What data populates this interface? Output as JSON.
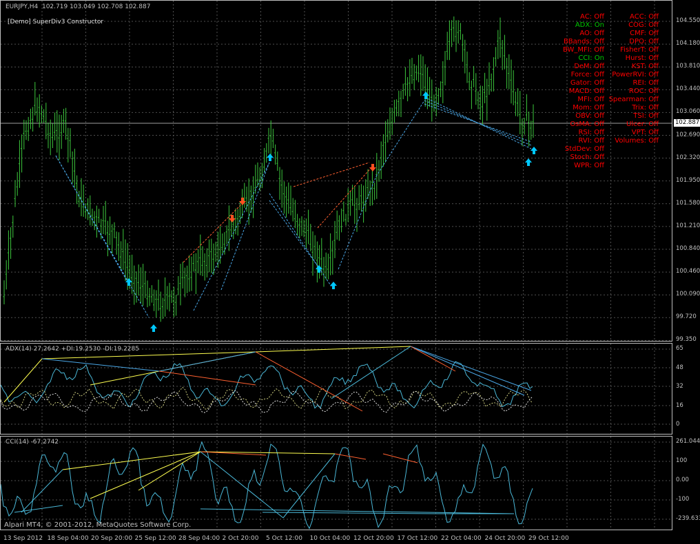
{
  "window": {
    "title": "EURJPY,H4  102.719 103.049 102.708 102.887",
    "indicator_label": "[Demo] SuperDiv3 Constructor",
    "copyright": "Alpari MT4, © 2001-2012, MetaQuotes Software Corp."
  },
  "colors": {
    "background": "#000000",
    "grid": "#606060",
    "bars": "#3cc83c",
    "up_arrow": "#00c8ff",
    "down_arrow": "#ff5020",
    "bull_line": "#4aa8e8",
    "bear_line": "#ff6030",
    "yellow_line": "#ffff50"
  },
  "price_axis": {
    "labels": [
      "104.550",
      "104.180",
      "103.810",
      "103.440",
      "103.060",
      "102.690",
      "102.320",
      "101.950",
      "101.580",
      "101.210",
      "100.840",
      "100.460",
      "100.090",
      "99.720",
      "99.350"
    ],
    "current": "102.887"
  },
  "adx": {
    "title": "ADX(14) 27.2642 +DI:19.2530 -DI:19.2285",
    "axis": [
      "65",
      "48",
      "32",
      "16",
      "0"
    ]
  },
  "cci": {
    "title": "CCI(14) -67.2742",
    "axis": [
      "261.044",
      "100",
      "0.00",
      "-100",
      "-239.633"
    ]
  },
  "time_axis": [
    "13 Sep 2012",
    "18 Sep 04:00",
    "20 Sep 20:00",
    "25 Sep 12:00",
    "28 Sep 04:00",
    "2 Oct 20:00",
    "5 Oct 12:00",
    "10 Oct 04:00",
    "12 Oct 20:00",
    "17 Oct 12:00",
    "22 Oct 04:00",
    "24 Oct 20:00",
    "29 Oct 12:00"
  ],
  "indicators_left": [
    {
      "label": "AC: Off",
      "state": "off"
    },
    {
      "label": "ADX: On",
      "state": "on"
    },
    {
      "label": "AO: Off",
      "state": "off"
    },
    {
      "label": "BBands: Off",
      "state": "off"
    },
    {
      "label": "BW_MFI: Off",
      "state": "off"
    },
    {
      "label": "CCI: On",
      "state": "on"
    },
    {
      "label": "DeM: Off",
      "state": "off"
    },
    {
      "label": "Force: Off",
      "state": "off"
    },
    {
      "label": "Gator: Off",
      "state": "off"
    },
    {
      "label": "MACD: Off",
      "state": "off"
    },
    {
      "label": "MFI: Off",
      "state": "off"
    },
    {
      "label": "Mom: Off",
      "state": "off"
    },
    {
      "label": "OBV: Off",
      "state": "off"
    },
    {
      "label": "OsMA: Off",
      "state": "off"
    },
    {
      "label": "RSI: Off",
      "state": "off"
    },
    {
      "label": "RVI: Off",
      "state": "off"
    },
    {
      "label": "StdDev: Off",
      "state": "off"
    },
    {
      "label": "Stoch: Off",
      "state": "off"
    },
    {
      "label": "WPR: Off",
      "state": "off"
    }
  ],
  "indicators_right": [
    {
      "label": "ACC: Off",
      "state": "off"
    },
    {
      "label": "COG: Off",
      "state": "off"
    },
    {
      "label": "CMF: Off",
      "state": "off"
    },
    {
      "label": "DPO: Off",
      "state": "off"
    },
    {
      "label": "FisherT: Off",
      "state": "off"
    },
    {
      "label": "Hurst: Off",
      "state": "off"
    },
    {
      "label": "KST: Off",
      "state": "off"
    },
    {
      "label": "PowerRVI: Off",
      "state": "off"
    },
    {
      "label": "REI: Off",
      "state": "off"
    },
    {
      "label": "ROC: Off",
      "state": "off"
    },
    {
      "label": "Spearman: Off",
      "state": "off"
    },
    {
      "label": "Trix: Off",
      "state": "off"
    },
    {
      "label": "TSI: Off",
      "state": "off"
    },
    {
      "label": "Ulcer: Off",
      "state": "off"
    },
    {
      "label": "VPT: Off",
      "state": "off"
    },
    {
      "label": "Volumes: Off",
      "state": "off"
    }
  ]
}
